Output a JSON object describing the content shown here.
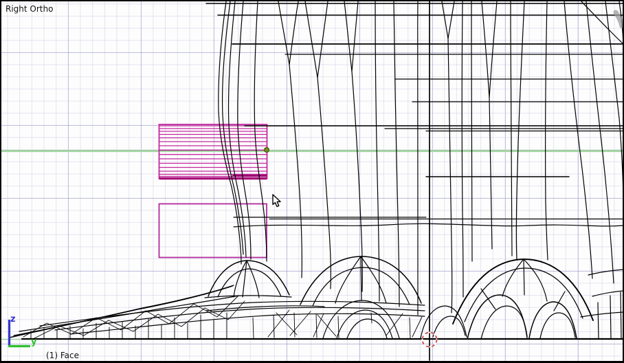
{
  "viewport": {
    "view_label": "Right Ortho",
    "status_label": "(1) Face",
    "mode": "wireframe-edit-mode",
    "axis_gizmo": {
      "z_label": "z",
      "y_label": "y"
    },
    "colors": {
      "background": "#fdfdfd",
      "grid_minor": "#e4e4f2",
      "grid_major": "#cfcfe8",
      "y_axis_line": "#8cc88c",
      "wireframe": "#000000",
      "selection_pink": "#c42a9e",
      "selection_dark_pink": "#9c0d72",
      "median_point_green": "#7e8e23",
      "cursor_3d_red": "#d04545",
      "gizmo_z_blue": "#3636d0",
      "gizmo_y_green": "#2fbf2f"
    }
  }
}
